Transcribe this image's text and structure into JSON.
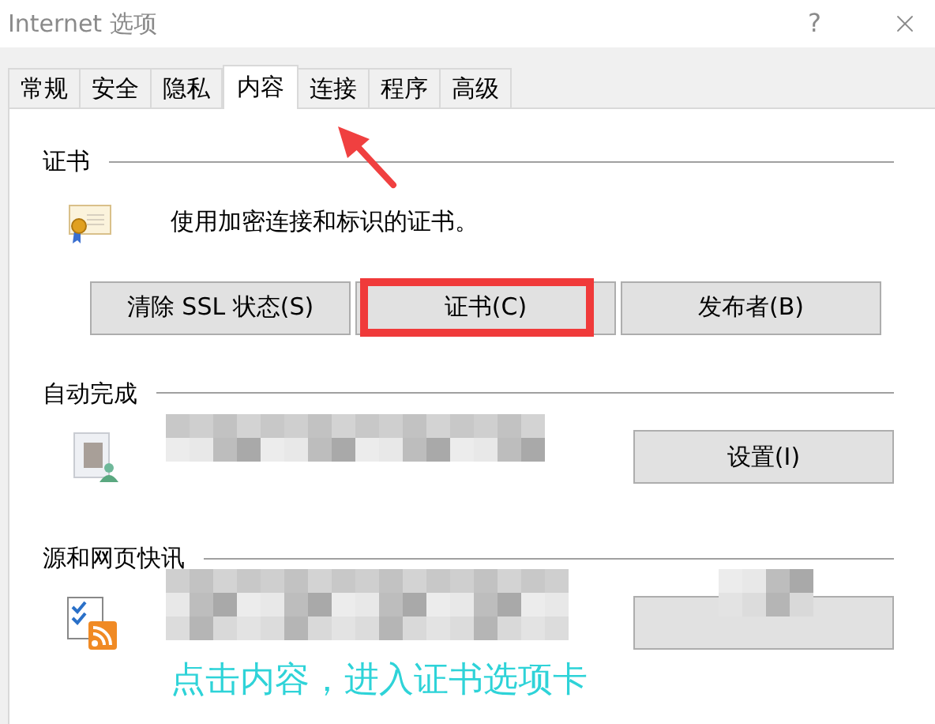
{
  "window": {
    "title": "Internet 选项",
    "help": "?"
  },
  "tabs": [
    {
      "label": "常规",
      "selected": false
    },
    {
      "label": "安全",
      "selected": false
    },
    {
      "label": "隐私",
      "selected": false
    },
    {
      "label": "内容",
      "selected": true
    },
    {
      "label": "连接",
      "selected": false
    },
    {
      "label": "程序",
      "selected": false
    },
    {
      "label": "高级",
      "selected": false
    }
  ],
  "sections": [
    {
      "kind": "certificates",
      "heading": "证书",
      "description": "使用加密连接和标识的证书。",
      "buttons": [
        "清除 SSL 状态(S)",
        "证书(C)",
        "发布者(B)"
      ]
    },
    {
      "kind": "autocomplete",
      "heading": "自动完成",
      "buttons": [
        "设置(I)"
      ]
    },
    {
      "kind": "feeds",
      "heading": "源和网页快讯"
    }
  ],
  "annotation": {
    "text": "点击内容，进入证书选项卡"
  }
}
